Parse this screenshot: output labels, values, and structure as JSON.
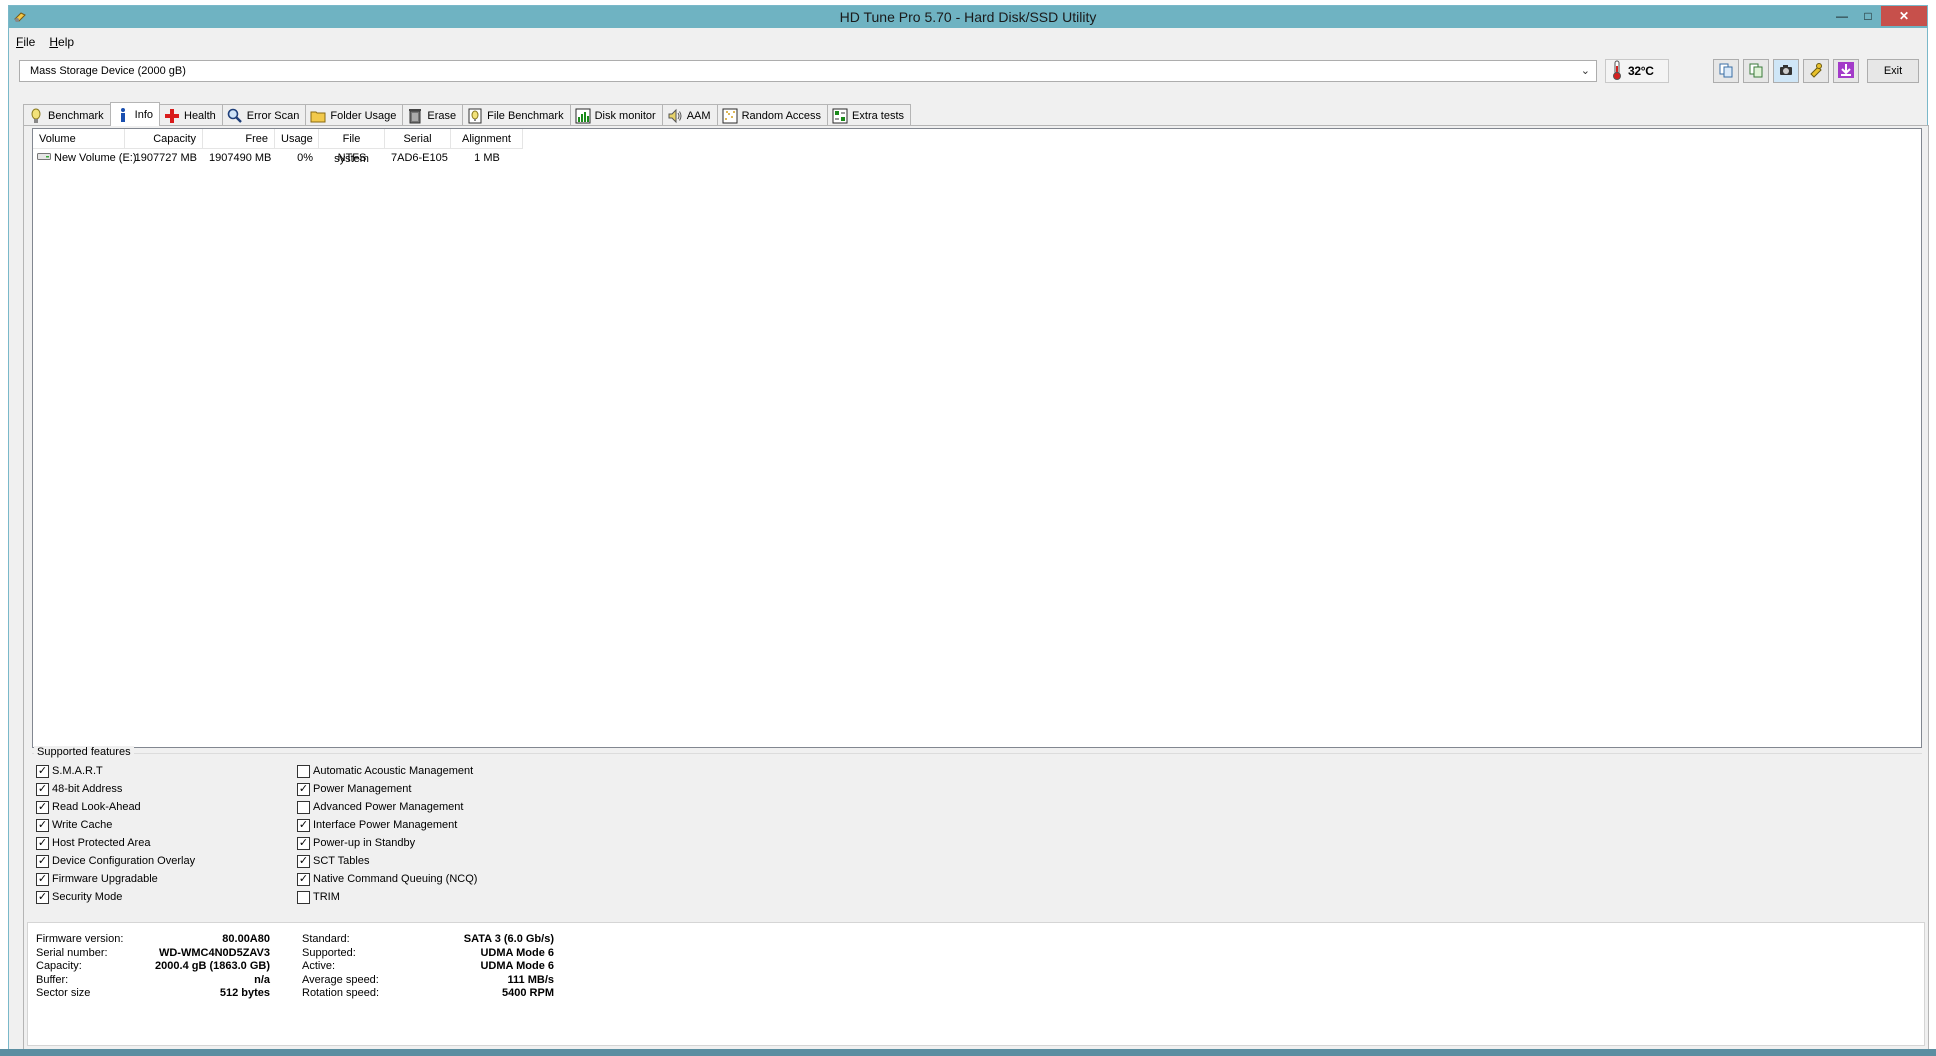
{
  "window": {
    "title": "HD Tune Pro 5.70 - Hard Disk/SSD Utility"
  },
  "menu": [
    {
      "label": "File",
      "accel": "F",
      "rest": "ile"
    },
    {
      "label": "Help",
      "accel": "H",
      "rest": "elp"
    }
  ],
  "toolbar": {
    "device": "Mass Storage Device (2000 gB)",
    "temperature": "32°C",
    "exit_label": "Exit",
    "tools": [
      "copy-info-icon",
      "copy-screen-icon",
      "screenshot-icon",
      "options-icon",
      "save-icon"
    ]
  },
  "tabs": [
    {
      "label": "Benchmark",
      "icon": "benchmark-icon",
      "active": false
    },
    {
      "label": "Info",
      "icon": "info-icon",
      "active": true
    },
    {
      "label": "Health",
      "icon": "health-icon",
      "active": false
    },
    {
      "label": "Error Scan",
      "icon": "error-scan-icon",
      "active": false
    },
    {
      "label": "Folder Usage",
      "icon": "folder-icon",
      "active": false
    },
    {
      "label": "Erase",
      "icon": "erase-icon",
      "active": false
    },
    {
      "label": "File Benchmark",
      "icon": "file-benchmark-icon",
      "active": false
    },
    {
      "label": "Disk monitor",
      "icon": "disk-monitor-icon",
      "active": false
    },
    {
      "label": "AAM",
      "icon": "speaker-icon",
      "active": false
    },
    {
      "label": "Random Access",
      "icon": "random-access-icon",
      "active": false
    },
    {
      "label": "Extra tests",
      "icon": "extra-tests-icon",
      "active": false
    }
  ],
  "volumes": {
    "columns": [
      "Volume",
      "Capacity",
      "Free",
      "Usage",
      "File system",
      "Serial",
      "Alignment"
    ],
    "rows": [
      {
        "volume": "New Volume (E:)",
        "capacity": "1907727 MB",
        "free": "1907490 MB",
        "usage": "0%",
        "fs": "NTFS",
        "serial": "7AD6-E105",
        "alignment": "1 MB"
      }
    ]
  },
  "features": {
    "label": "Supported features",
    "left": [
      {
        "label": "S.M.A.R.T",
        "checked": true
      },
      {
        "label": "48-bit Address",
        "checked": true
      },
      {
        "label": "Read Look-Ahead",
        "checked": true
      },
      {
        "label": "Write Cache",
        "checked": true
      },
      {
        "label": "Host Protected Area",
        "checked": true
      },
      {
        "label": "Device Configuration Overlay",
        "checked": true
      },
      {
        "label": "Firmware Upgradable",
        "checked": true
      },
      {
        "label": "Security Mode",
        "checked": true
      }
    ],
    "right": [
      {
        "label": "Automatic Acoustic Management",
        "checked": false
      },
      {
        "label": "Power Management",
        "checked": true
      },
      {
        "label": "Advanced Power Management",
        "checked": false
      },
      {
        "label": "Interface Power Management",
        "checked": true
      },
      {
        "label": "Power-up in Standby",
        "checked": true
      },
      {
        "label": "SCT Tables",
        "checked": true
      },
      {
        "label": "Native Command Queuing (NCQ)",
        "checked": true
      },
      {
        "label": "TRIM",
        "checked": false
      }
    ]
  },
  "info": {
    "left": [
      {
        "label": "Firmware version:",
        "value": "80.00A80"
      },
      {
        "label": "Serial number:",
        "value": "WD-WMC4N0D5ZAV3"
      },
      {
        "label": "Capacity:",
        "value": "2000.4 gB (1863.0 GB)"
      },
      {
        "label": "Buffer:",
        "value": "n/a"
      },
      {
        "label": "Sector size",
        "value": "512 bytes"
      }
    ],
    "right": [
      {
        "label": "Standard:",
        "value": "SATA 3 (6.0 Gb/s)"
      },
      {
        "label": "Supported:",
        "value": "UDMA Mode 6"
      },
      {
        "label": "Active:",
        "value": "UDMA Mode 6"
      },
      {
        "label": "Average speed:",
        "value": "111 MB/s"
      },
      {
        "label": "Rotation speed:",
        "value": "5400 RPM"
      }
    ]
  }
}
